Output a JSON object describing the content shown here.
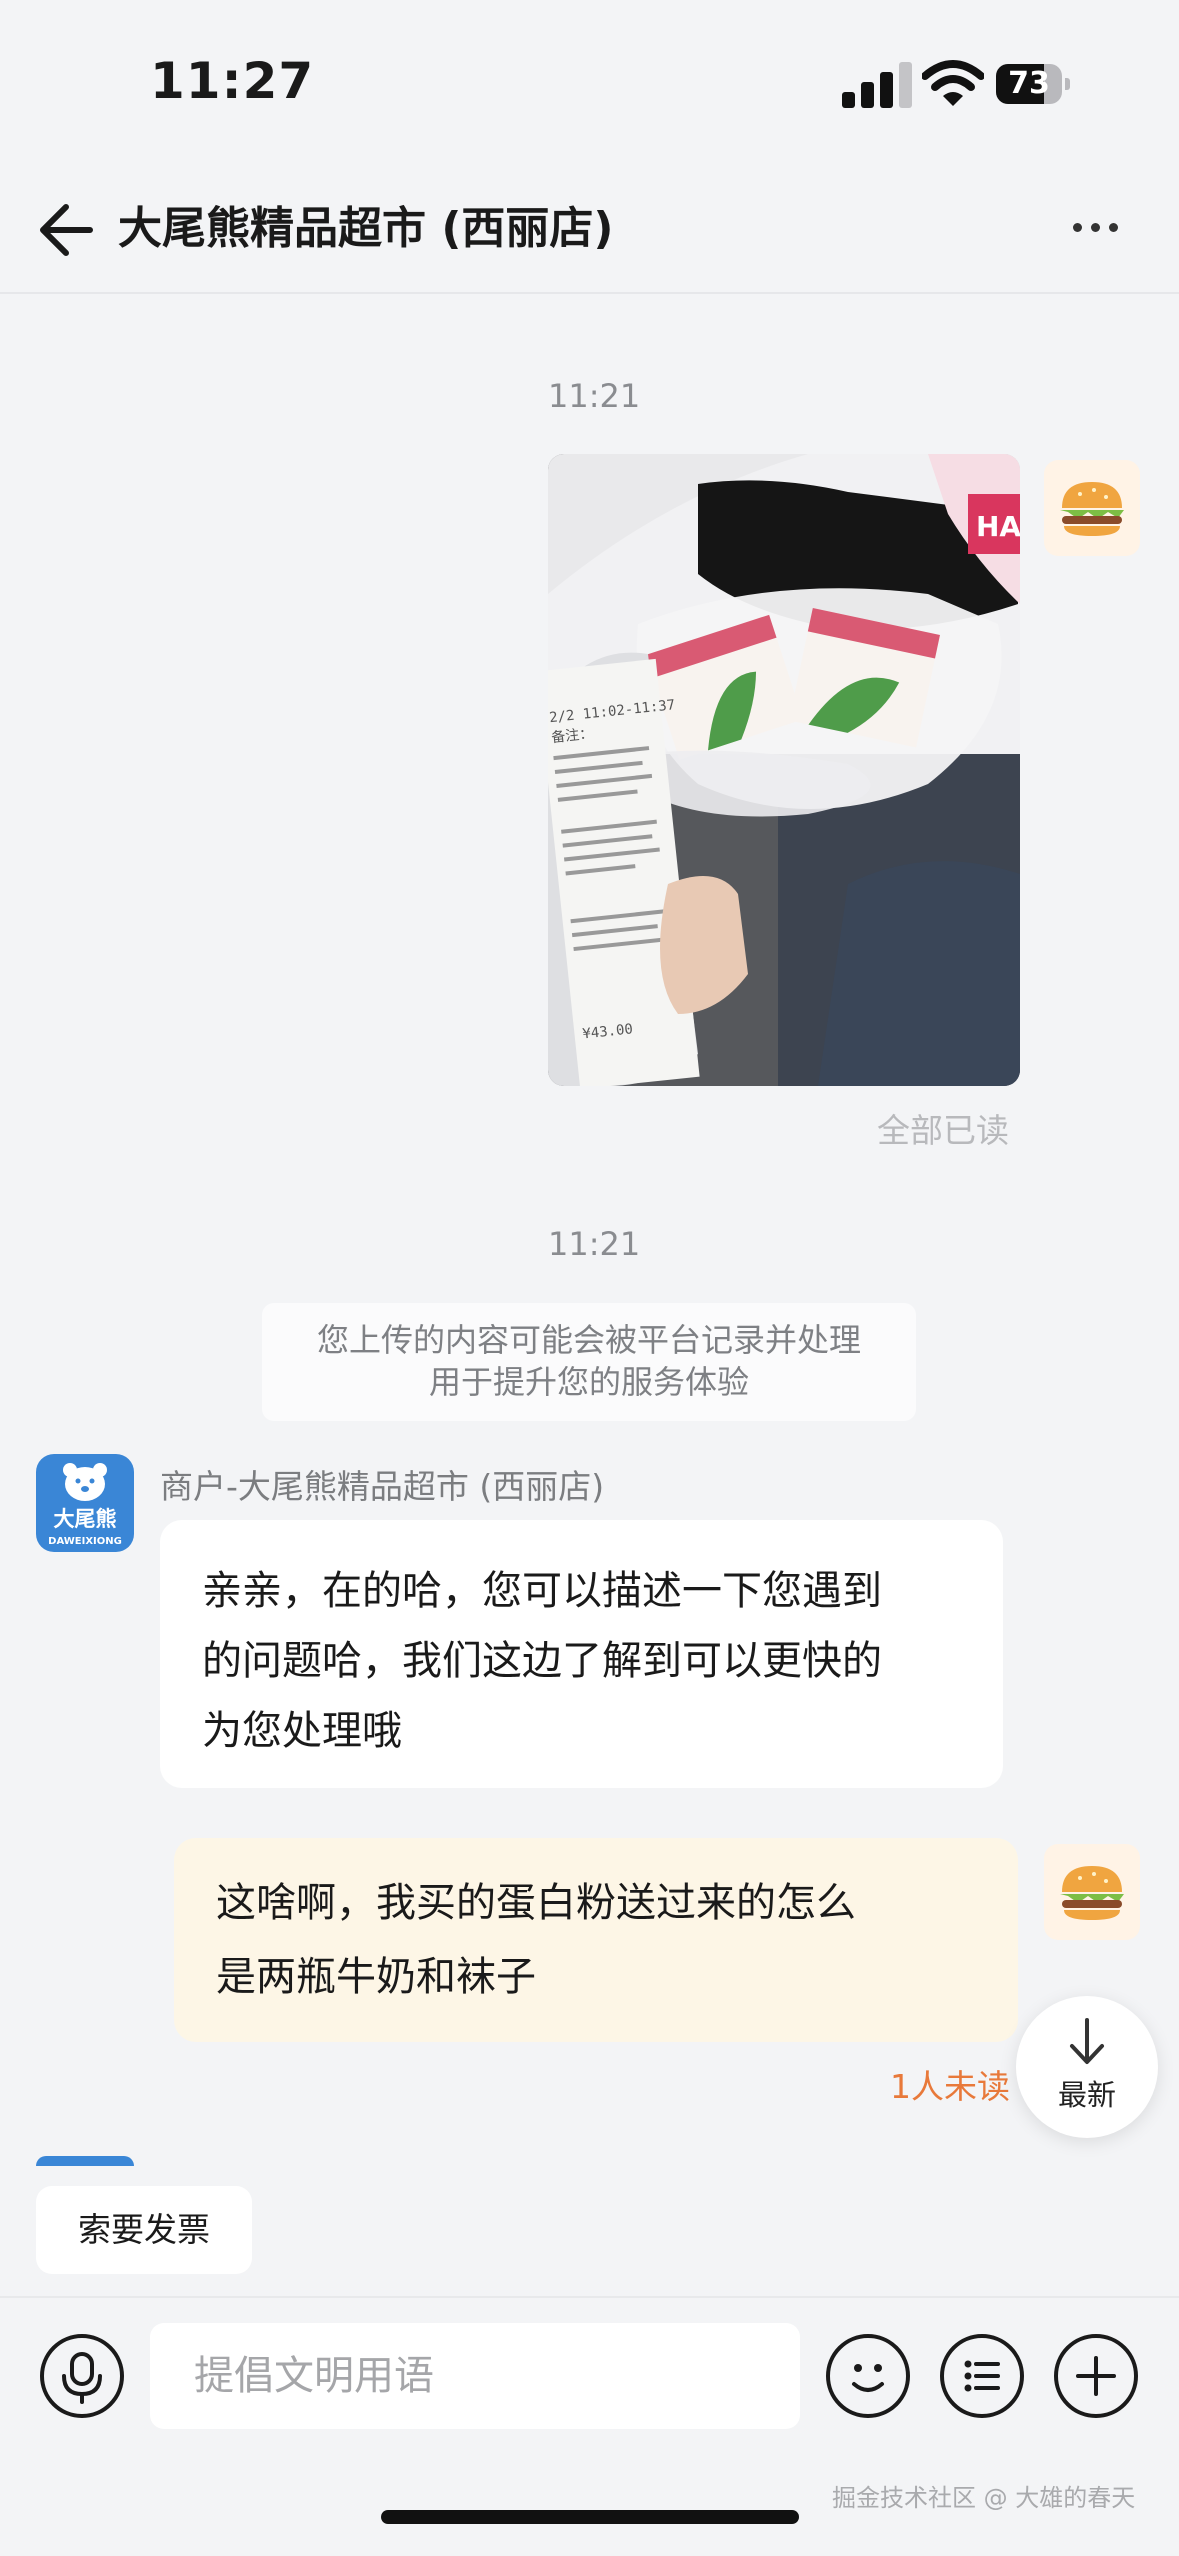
{
  "status_bar": {
    "time": "11:27",
    "battery": "73",
    "battery_level": 0.73
  },
  "header": {
    "title": "大尾熊精品超市 (西丽店)"
  },
  "chat": {
    "timestamp_1": "11:21",
    "read_status": "全部已读",
    "timestamp_2": "11:21",
    "system_notice": [
      "您上传的内容可能会被平台记录并处理",
      "用于提升您的服务体验"
    ],
    "merchant": {
      "name": "商户-大尾熊精品超市 (西丽店)",
      "logo_text": "大尾熊",
      "logo_subtext": "DAWEIXIONG",
      "message": [
        "亲亲，在的哈，您可以描述一下您遇到",
        "的问题哈，我们这边了解到可以更快的",
        "为您处理哦"
      ]
    },
    "user_message": [
      "这啥啊，我买的蛋白粉送过来的怎么",
      "是两瓶牛奶和袜子"
    ],
    "unread_status": "1人未读",
    "newest_button": "最新",
    "photo_receipt_text": [
      "2/2 11:02-11:37",
      "备注：",
      "¥43.00"
    ],
    "photo_box_text": "HAS"
  },
  "quick_actions": {
    "invoice": "索要发票"
  },
  "input": {
    "placeholder": "提倡文明用语"
  },
  "watermark": "掘金技术社区 @ 大雄的春天",
  "colors": {
    "accent_unread": "#e8793a",
    "user_bubble": "#fdf6e6",
    "merchant_logo": "#3a86d6"
  }
}
